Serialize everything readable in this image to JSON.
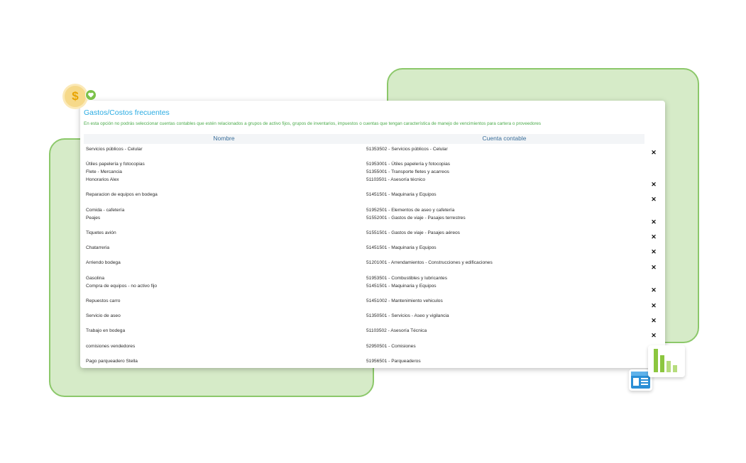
{
  "page": {
    "title": "Gastos/Costos frecuentes",
    "notice": "En esta opción no podrás seleccionar cuentas contables que estén relacionados a grupos de activo fijos, grupos de inventarios, impuestos o cuentas que tengan característica de manejo de vencimientos para cartera o proveedores"
  },
  "table": {
    "columns": [
      "Nombre",
      "Cuenta contable"
    ],
    "rows": [
      {
        "name": "Servicios públicos - Celular",
        "account": "51353502 - Servicios públicos - Celular",
        "delete": "✕"
      },
      {
        "name": "Útiles papelería y fotocopias",
        "account": "51953001 - Útiles papelería y fotocopias",
        "delete": ""
      },
      {
        "name": "Flete - Mercancia",
        "account": "51355001 - Transporte fletes y acarreos",
        "delete": ""
      },
      {
        "name": "Honorarios Alex",
        "account": "51103501 - Asesoría técnico",
        "delete": "✕"
      },
      {
        "name": "Reparacion de equipos en bodega",
        "account": "51451501 - Maquinaria y Equipos",
        "delete": "✕"
      },
      {
        "name": "Comida - cafetería",
        "account": "51952501 - Elementos de aseo y cafetería",
        "delete": ""
      },
      {
        "name": "Peajes",
        "account": "51552001 - Gastos de viaje - Pasajes terrestres",
        "delete": "✕"
      },
      {
        "name": "Tiquetes avión",
        "account": "51551501 - Gastos de viaje - Pasajes aéreos",
        "delete": "✕"
      },
      {
        "name": "Chatarreria",
        "account": "51451501 - Maquinaria y Equipos",
        "delete": "✕"
      },
      {
        "name": "Arriendo bodega",
        "account": "51201001 - Arrendamientos - Construcciones y edificaciones",
        "delete": "✕"
      },
      {
        "name": "Gasolina",
        "account": "51953501 - Combustibles y lubricantes",
        "delete": ""
      },
      {
        "name": "Compra de equipos - no activo fijo",
        "account": "51451501 - Maquinaria y Equipos",
        "delete": "✕"
      },
      {
        "name": "Repuestos carro",
        "account": "51451002 - Mantenimiento vehiculos",
        "delete": "✕"
      },
      {
        "name": "Servicio de aseo",
        "account": "51350501 - Servicios - Aseo y vigilancia",
        "delete": "✕"
      },
      {
        "name": "Trabajo en bodega",
        "account": "51103502 - Asesoría Técnica",
        "delete": "✕"
      },
      {
        "name": "comisiones vendedores",
        "account": "52950501 - Comisiones",
        "delete": ""
      },
      {
        "name": "Pago parqueadero Stella",
        "account": "51956501 - Parqueaderos",
        "delete": ""
      }
    ]
  },
  "decor": {
    "coin_symbol": "$",
    "colors": {
      "green_panel": "#d6ebc8",
      "green_border": "#8cc86a",
      "title_blue": "#29abe2",
      "notice_green": "#4aaa4a"
    },
    "icons": [
      "dollar-coin-icon",
      "heart-badge-icon",
      "document-icon",
      "bar-chart-icon"
    ]
  }
}
